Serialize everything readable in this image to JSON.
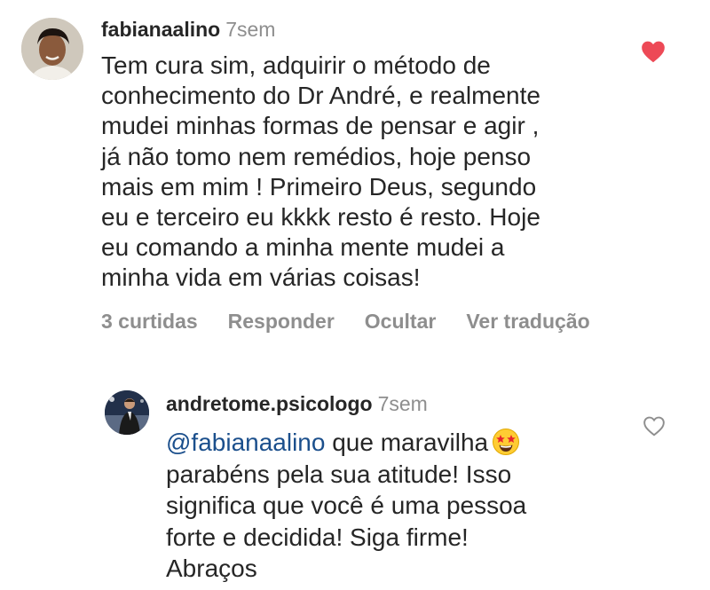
{
  "comment": {
    "username": "fabianaalino",
    "time": "7sem",
    "body_lines": [
      "Tem cura sim, adquirir o método de",
      "conhecimento do Dr André, e realmente",
      "mudei minhas formas de pensar e agir ,",
      "já não tomo nem remédios, hoje penso",
      "mais em mim ! Primeiro Deus, segundo",
      "eu e terceiro eu kkkk resto é resto. Hoje",
      "eu comando a minha mente mudei a",
      "minha vida em várias coisas!"
    ],
    "likes_label": "3 curtidas",
    "reply_label": "Responder",
    "hide_label": "Ocultar",
    "translate_label": "Ver tradução",
    "liked": true,
    "heart_color": "#ed4956"
  },
  "reply": {
    "username": "andretome.psicologo",
    "time": "7sem",
    "mention": "@fabianaalino",
    "first_line_rest": " que maravilha",
    "emoji": "star-struck-emoji",
    "body_lines": [
      "parabéns pela sua atitude! Isso",
      "significa que você é uma pessoa",
      "forte e decidida! Siga firme!",
      "Abraços"
    ],
    "liked": false
  },
  "colors": {
    "text": "#262626",
    "secondary": "#8e8e8e",
    "mention": "#1b4f8c"
  }
}
